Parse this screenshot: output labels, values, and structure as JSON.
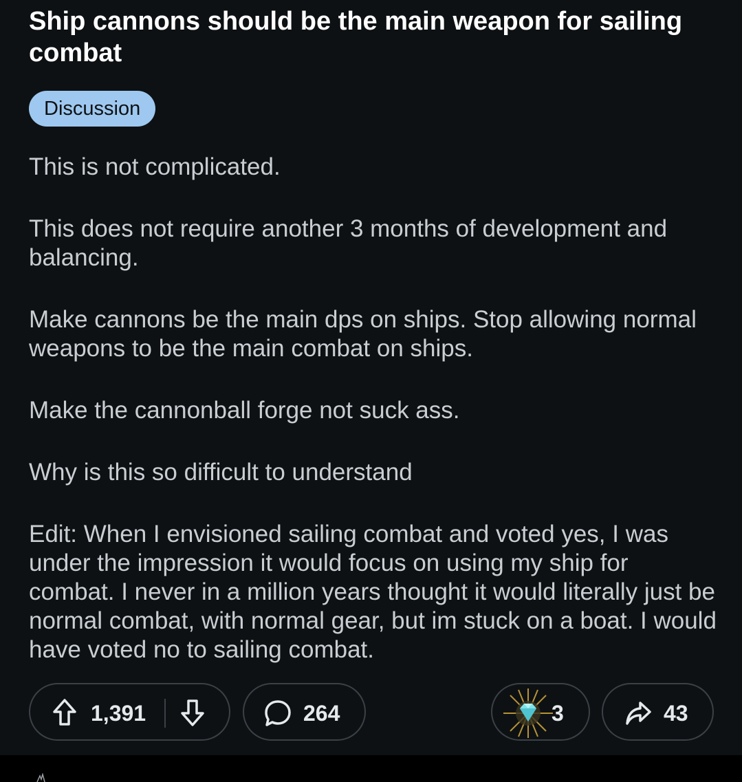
{
  "post": {
    "title": "Ship cannons should be the main weapon for sailing combat",
    "flair": "Discussion",
    "body": [
      "This is not complicated.",
      "This does not require another 3 months of development and balancing.",
      "Make cannons be the main dps on ships. Stop allowing normal weapons to be the main combat on ships.",
      "Make the cannonball forge not suck ass.",
      "Why is this so difficult to understand",
      "Edit: When I envisioned sailing combat and voted yes, I was under the impression it would focus on using my ship for combat. I never in a million years thought it would literally just be normal combat, with normal gear, but im stuck on a boat. I would have voted no to sailing combat."
    ]
  },
  "actions": {
    "score": "1,391",
    "comments": "264",
    "awards": "3",
    "shares": "43"
  },
  "icons": {
    "upvote": "upvote-arrow-icon",
    "downvote": "downvote-arrow-icon",
    "comment": "speech-bubble-icon",
    "award": "diamond-award-icon",
    "share": "share-arrow-icon"
  },
  "colors": {
    "background": "#0e1113",
    "flair_bg": "#9ec8f0",
    "title": "#ffffff",
    "body_text": "#c9ced3",
    "pill_border": "#3a4147",
    "award_gem": "#7fe3e8"
  }
}
